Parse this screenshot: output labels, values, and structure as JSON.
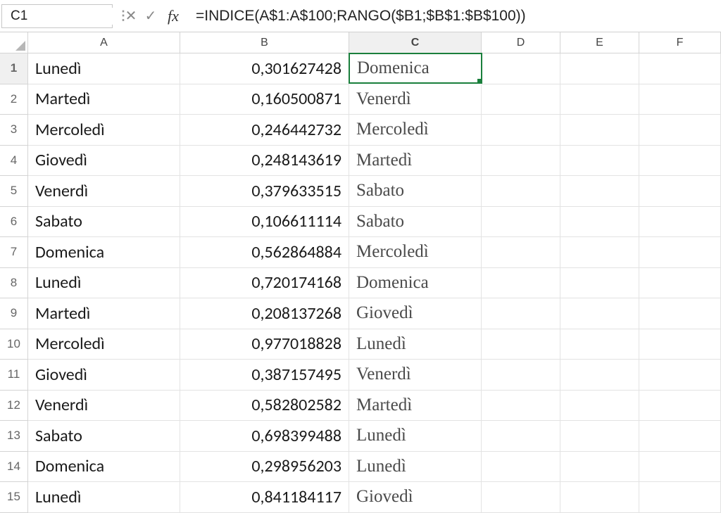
{
  "nameBox": "C1",
  "formula": "=INDICE(A$1:A$100;RANGO($B1;$B$1:$B$100))",
  "columns": [
    "A",
    "B",
    "C",
    "D",
    "E",
    "F"
  ],
  "selected": {
    "row": 1,
    "col": "C",
    "rowIdx": 0,
    "colIdx": 2
  },
  "rows": [
    {
      "n": "1",
      "a": "Lunedì",
      "b": "0,301627428",
      "c": "Domenica"
    },
    {
      "n": "2",
      "a": "Martedì",
      "b": "0,160500871",
      "c": "Venerdì"
    },
    {
      "n": "3",
      "a": "Mercoledì",
      "b": "0,246442732",
      "c": "Mercoledì"
    },
    {
      "n": "4",
      "a": "Giovedì",
      "b": "0,248143619",
      "c": "Martedì"
    },
    {
      "n": "5",
      "a": "Venerdì",
      "b": "0,379633515",
      "c": "Sabato"
    },
    {
      "n": "6",
      "a": "Sabato",
      "b": "0,106611114",
      "c": "Sabato"
    },
    {
      "n": "7",
      "a": "Domenica",
      "b": "0,562864884",
      "c": "Mercoledì"
    },
    {
      "n": "8",
      "a": "Lunedì",
      "b": "0,720174168",
      "c": "Domenica"
    },
    {
      "n": "9",
      "a": "Martedì",
      "b": "0,208137268",
      "c": "Giovedì"
    },
    {
      "n": "10",
      "a": "Mercoledì",
      "b": "0,977018828",
      "c": "Lunedì"
    },
    {
      "n": "11",
      "a": "Giovedì",
      "b": "0,387157495",
      "c": "Venerdì"
    },
    {
      "n": "12",
      "a": "Venerdì",
      "b": "0,582802582",
      "c": "Martedì"
    },
    {
      "n": "13",
      "a": "Sabato",
      "b": "0,698399488",
      "c": "Lunedì"
    },
    {
      "n": "14",
      "a": "Domenica",
      "b": "0,298956203",
      "c": "Lunedì"
    },
    {
      "n": "15",
      "a": "Lunedì",
      "b": "0,841184117",
      "c": "Giovedì"
    }
  ],
  "fbIcons": {
    "cancel": "✕",
    "confirm": "✓",
    "fx": "fx",
    "chevron": "⌄"
  }
}
